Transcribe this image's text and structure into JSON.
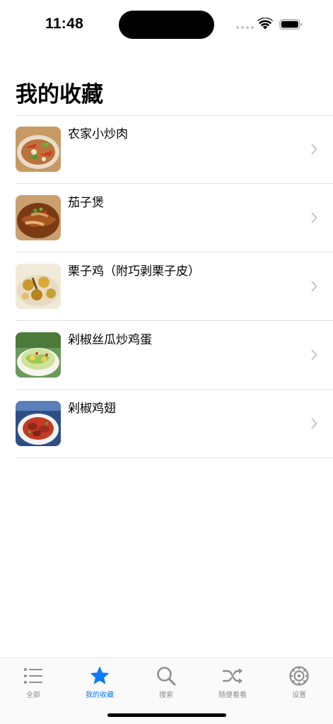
{
  "status_bar": {
    "time": "11:48"
  },
  "page": {
    "title": "我的收藏"
  },
  "favorites": [
    {
      "title": "农家小炒肉",
      "icon": "dish-photo"
    },
    {
      "title": "茄子煲",
      "icon": "dish-photo"
    },
    {
      "title": "栗子鸡（附巧剥栗子皮）",
      "icon": "dish-photo"
    },
    {
      "title": "剁椒丝瓜炒鸡蛋",
      "icon": "dish-photo"
    },
    {
      "title": "剁椒鸡翅",
      "icon": "dish-photo"
    }
  ],
  "tab_bar": {
    "tabs": [
      {
        "label": "全部",
        "icon": "list-icon"
      },
      {
        "label": "我的收藏",
        "icon": "star-icon",
        "active": true
      },
      {
        "label": "搜索",
        "icon": "search-icon"
      },
      {
        "label": "随便看看",
        "icon": "shuffle-icon"
      },
      {
        "label": "设置",
        "icon": "gear-icon"
      }
    ]
  },
  "colors": {
    "accent": "#0a7aff",
    "inactive": "#8e8e93",
    "divider": "#e2e2e4"
  }
}
